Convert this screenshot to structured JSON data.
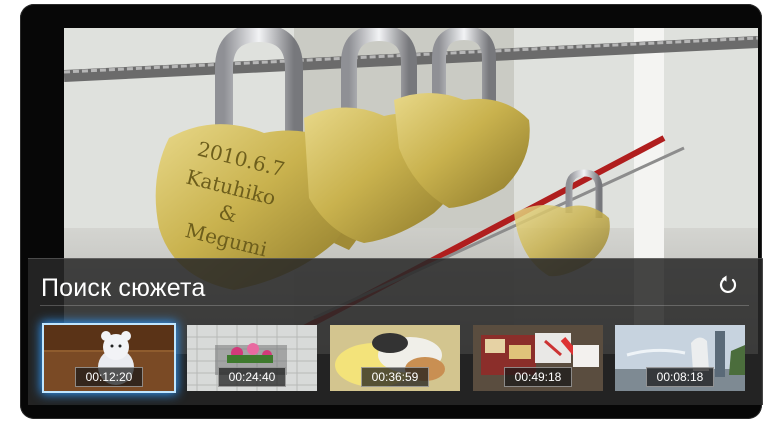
{
  "scene_search": {
    "title": "Поиск сюжета",
    "refresh_icon": "refresh-icon",
    "thumbnails": [
      {
        "time": "00:12:20",
        "selected": true,
        "subject": "toy bear"
      },
      {
        "time": "00:24:40",
        "selected": false,
        "subject": "flowers in box"
      },
      {
        "time": "00:36:59",
        "selected": false,
        "subject": "food plate"
      },
      {
        "time": "00:49:18",
        "selected": false,
        "subject": "shoes"
      },
      {
        "time": "00:08:18",
        "selected": false,
        "subject": "merlion"
      }
    ]
  },
  "video": {
    "lock_engraving": {
      "line1": "2010.6.7",
      "line2": "Katuhiko",
      "line3": "&",
      "line4": "Megumi"
    }
  },
  "colors": {
    "selection_glow": "#2f9bff",
    "panel_bg": "#282828",
    "tv_frame": "#070707"
  }
}
